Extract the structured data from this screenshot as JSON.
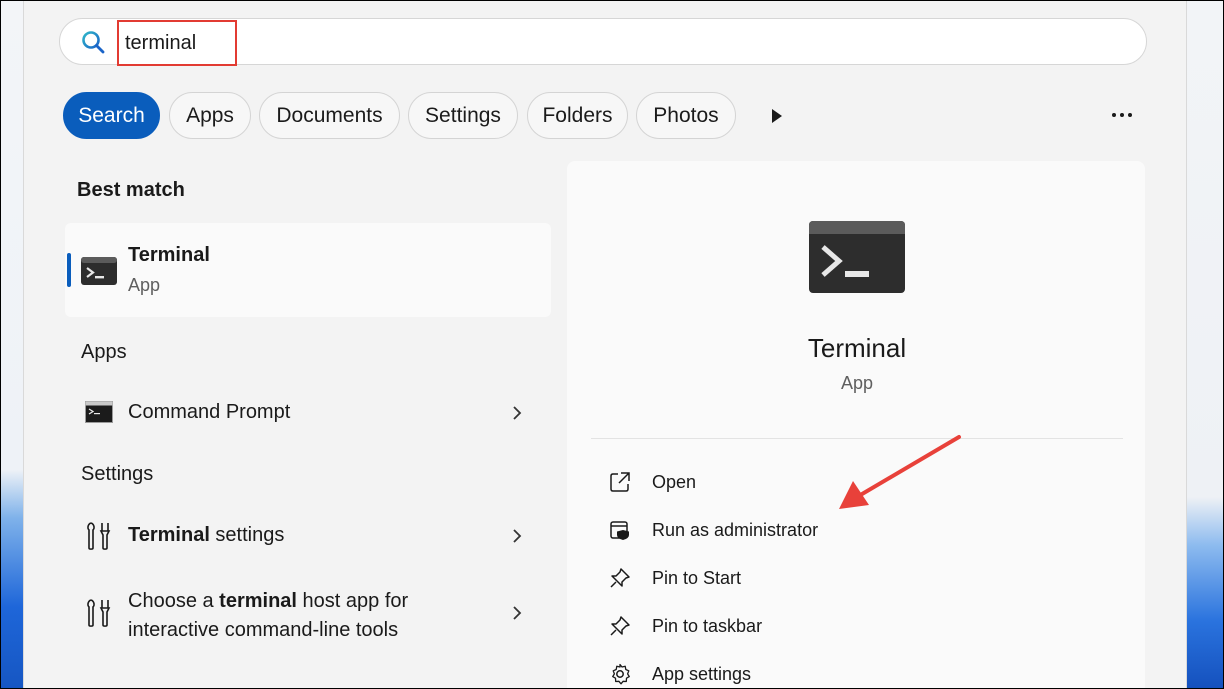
{
  "search": {
    "query": "terminal"
  },
  "filters": [
    "Search",
    "Apps",
    "Documents",
    "Settings",
    "Folders",
    "Photos"
  ],
  "best_match": {
    "heading": "Best match",
    "title": "Terminal",
    "subtitle": "App"
  },
  "apps": {
    "heading": "Apps",
    "items": [
      {
        "label": "Command Prompt"
      }
    ]
  },
  "settings": {
    "heading": "Settings",
    "items": [
      {
        "bold": "Terminal",
        "rest": " settings"
      },
      {
        "pre": "Choose a ",
        "bold": "terminal",
        "rest": " host app for",
        "line2": "interactive command-line tools"
      }
    ]
  },
  "detail": {
    "title": "Terminal",
    "subtitle": "App",
    "actions": [
      "Open",
      "Run as administrator",
      "Pin to Start",
      "Pin to taskbar",
      "App settings"
    ]
  },
  "colors": {
    "accent": "#0a5dbc",
    "highlight_box": "#e23b32",
    "annotation_arrow": "#e8413a"
  }
}
